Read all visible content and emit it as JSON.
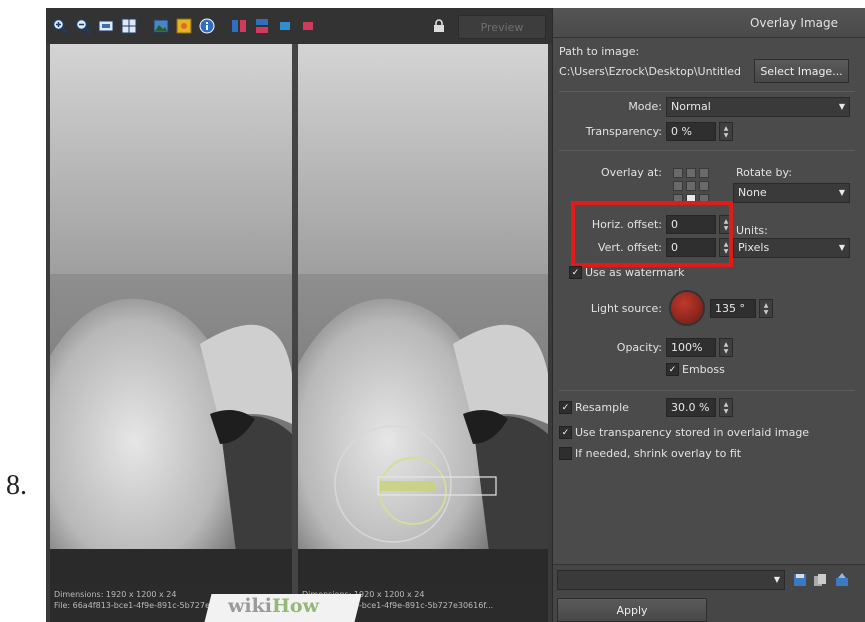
{
  "step_number": "8.",
  "toolbar": {
    "preview_label": "Preview",
    "icons": [
      "zoom-in-icon",
      "zoom-out-icon",
      "fit-icon",
      "full-icon",
      "image-icon",
      "color-icon",
      "info-icon",
      "split-vertical-icon",
      "split-horizontal-icon",
      "single-a-icon",
      "single-b-icon",
      "lock-icon"
    ]
  },
  "left_status": {
    "dimensions": "Dimensions: 1920 x 1200 x 24",
    "file": "File: 66a4f813-bce1-4f9e-891c-5b727e30616f..."
  },
  "right_status": {
    "dimensions": "Dimensions: 1920 x 1200 x 24",
    "file": "File: 66a4f813-bce1-4f9e-891c-5b727e30616f..."
  },
  "panel": {
    "title": "Overlay Image",
    "path_label": "Path to image:",
    "path_value": "C:\\Users\\Ezrock\\Desktop\\Untitled",
    "select_image_label": "Select Image...",
    "mode_label": "Mode:",
    "mode_value": "Normal",
    "transparency_label": "Transparency:",
    "transparency_value": "0 %",
    "overlay_at_label": "Overlay at:",
    "rotate_by_label": "Rotate by:",
    "rotate_by_value": "None",
    "horiz_offset_label": "Horiz. offset:",
    "horiz_offset_value": "0",
    "vert_offset_label": "Vert. offset:",
    "vert_offset_value": "0",
    "units_label": "Units:",
    "units_value": "Pixels",
    "watermark_label": "Use as watermark",
    "light_source_label": "Light source:",
    "light_source_value": "135 °",
    "opacity_label": "Opacity:",
    "opacity_value": "100%",
    "emboss_label": "Emboss",
    "resample_label": "Resample",
    "resample_value": "30.0 %",
    "use_transparency_label": "Use transparency stored in overlaid image",
    "shrink_label": "If needed, shrink overlay to fit",
    "apply_label": "Apply"
  },
  "watermark": {
    "wiki": "wiki",
    "how": "How"
  },
  "colors": {
    "highlight": "#e11a1a",
    "panel_bg": "#4b4b4b",
    "toolbar_bg": "#333333"
  }
}
